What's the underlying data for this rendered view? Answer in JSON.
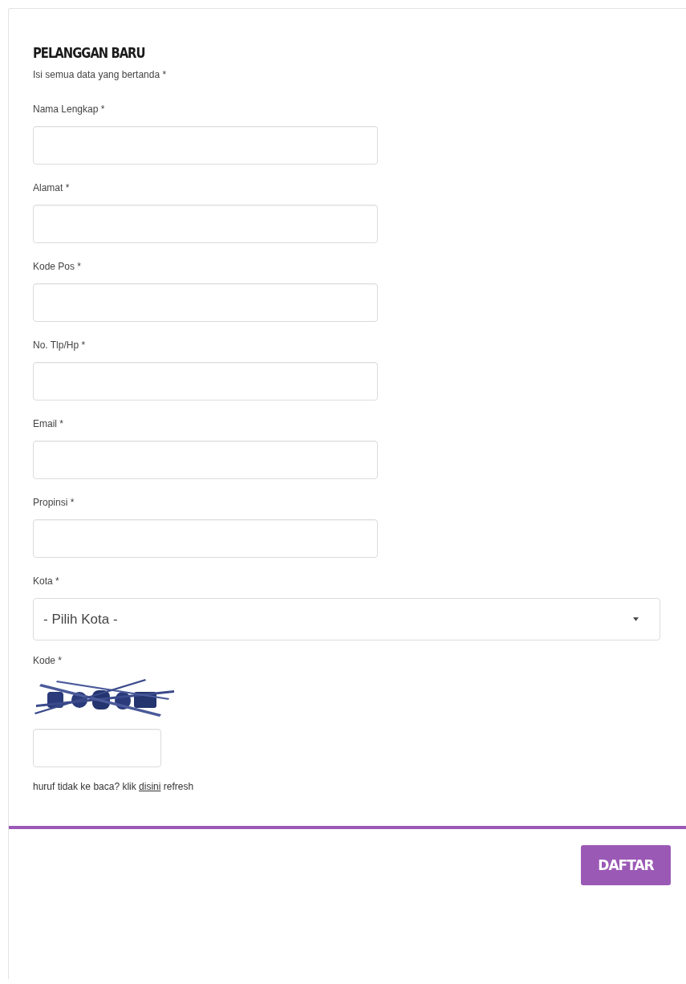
{
  "form": {
    "title": "PELANGGAN BARU",
    "note": "Isi semua data yang bertanda *",
    "fields": [
      {
        "kind": "text",
        "label": "Nama Lengkap *"
      },
      {
        "kind": "text",
        "label": "Alamat *"
      },
      {
        "kind": "text",
        "label": "Kode Pos *"
      },
      {
        "kind": "text",
        "label": "No. Tlp/Hp *"
      },
      {
        "kind": "text",
        "label": "Email *"
      },
      {
        "kind": "text",
        "label": "Propinsi *"
      },
      {
        "kind": "select",
        "label": "Kota *",
        "value": "- Pilih Kota -"
      },
      {
        "kind": "captcha",
        "label": "Kode *"
      }
    ],
    "refresh_hint": {
      "before": "huruf tidak ke baca? klik",
      "link": "disini",
      "after": "refresh"
    },
    "submit": "DAFTAR"
  }
}
